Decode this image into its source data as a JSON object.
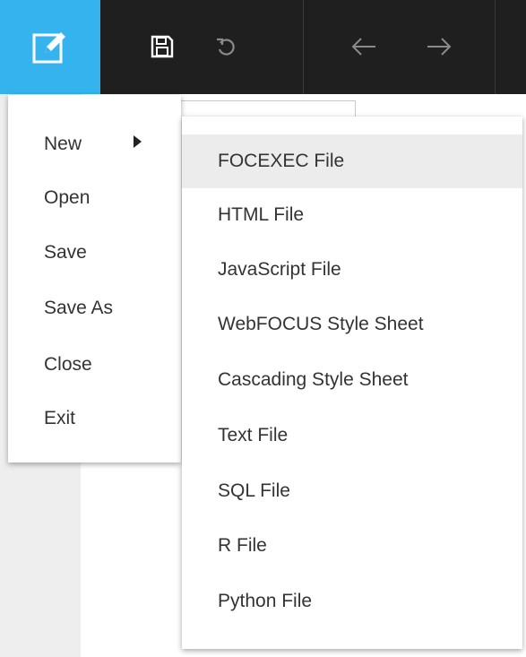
{
  "colors": {
    "toolbar_bg": "#1f1f1f",
    "file_button_bg": "#35b3ef",
    "menu_bg": "#ffffff",
    "highlight_bg": "#ececec",
    "text": "#333333"
  },
  "toolbar": {
    "icons": [
      "edit-icon",
      "save-icon",
      "refresh-icon",
      "back-arrow-icon",
      "forward-arrow-icon"
    ]
  },
  "file_menu": {
    "items": [
      {
        "label": "New"
      },
      {
        "label": "Open"
      },
      {
        "label": "Save"
      },
      {
        "label": "Save As"
      },
      {
        "label": "Close"
      },
      {
        "label": "Exit"
      }
    ]
  },
  "new_submenu": {
    "highlighted": "FOCEXEC File",
    "items": [
      {
        "label": "FOCEXEC File"
      },
      {
        "label": "HTML File"
      },
      {
        "label": "JavaScript File"
      },
      {
        "label": "WebFOCUS Style Sheet"
      },
      {
        "label": "Cascading Style Sheet"
      },
      {
        "label": "Text File"
      },
      {
        "label": "SQL File"
      },
      {
        "label": "R File"
      },
      {
        "label": "Python File"
      }
    ]
  }
}
